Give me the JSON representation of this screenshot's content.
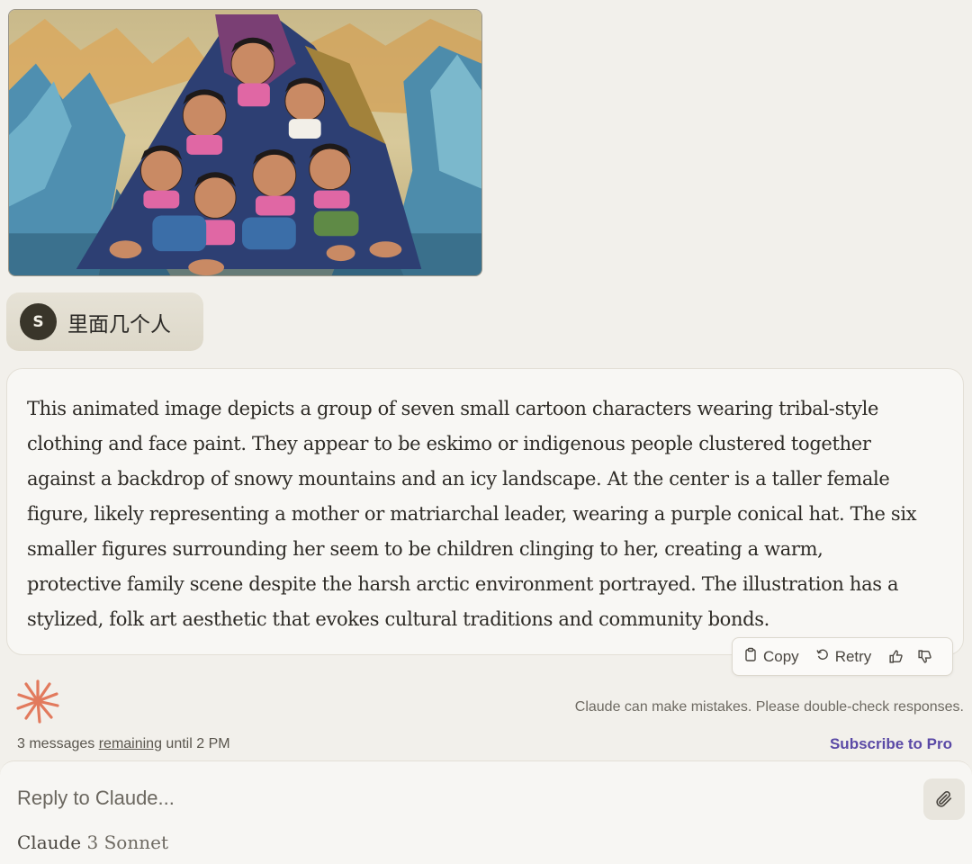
{
  "attachment": {
    "icon": "image-thumbnail"
  },
  "user_message": {
    "avatar_letter": "S",
    "text": "里面几个人"
  },
  "assistant_message": {
    "text": "This animated image depicts a group of seven small cartoon characters wearing tribal-style clothing and face paint. They appear to be eskimo or indigenous people clustered together against a backdrop of snowy mountains and an icy landscape. At the center is a taller female figure, likely representing a mother or matriarchal leader, wearing a purple conical hat. The six smaller figures surrounding her seem to be children clinging to her, creating a warm, protective family scene despite the harsh arctic environment portrayed. The illustration has a stylized, folk art aesthetic that evokes cultural traditions and community bonds."
  },
  "actions": {
    "copy_label": "Copy",
    "retry_label": "Retry"
  },
  "disclaimer": "Claude can make mistakes. Please double-check responses.",
  "limit": {
    "prefix": "3 messages ",
    "remaining": "remaining",
    "suffix": " until 2 PM"
  },
  "subscribe_label": "Subscribe to Pro",
  "composer": {
    "placeholder": "Reply to Claude...",
    "model_brand": "Claude",
    "model_version": "3 Sonnet"
  },
  "colors": {
    "background": "#f2f0eb",
    "accent_link": "#5a49a6",
    "claude_logo": "#e27a5d"
  }
}
